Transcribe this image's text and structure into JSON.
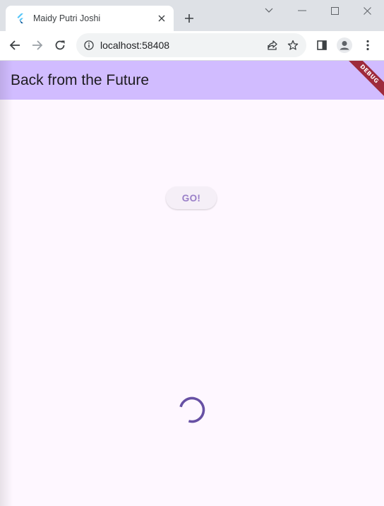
{
  "browser": {
    "tab": {
      "title": "Maidy Putri Joshi",
      "favicon": "flutter-logo-icon"
    },
    "address": {
      "url": "localhost:58408"
    },
    "colors": {
      "tabstrip": "#dee1e6",
      "toolbar": "#ffffff",
      "omnibox": "#f1f3f4"
    }
  },
  "app": {
    "title": "Back from the Future",
    "debug_label": "DEBUG",
    "go_button_label": "GO!",
    "loading": true,
    "colors": {
      "appbar": "#d1bcff",
      "background": "#fef7ff",
      "accent": "#6750a4",
      "debug_ribbon": "#9e2b3c"
    }
  }
}
